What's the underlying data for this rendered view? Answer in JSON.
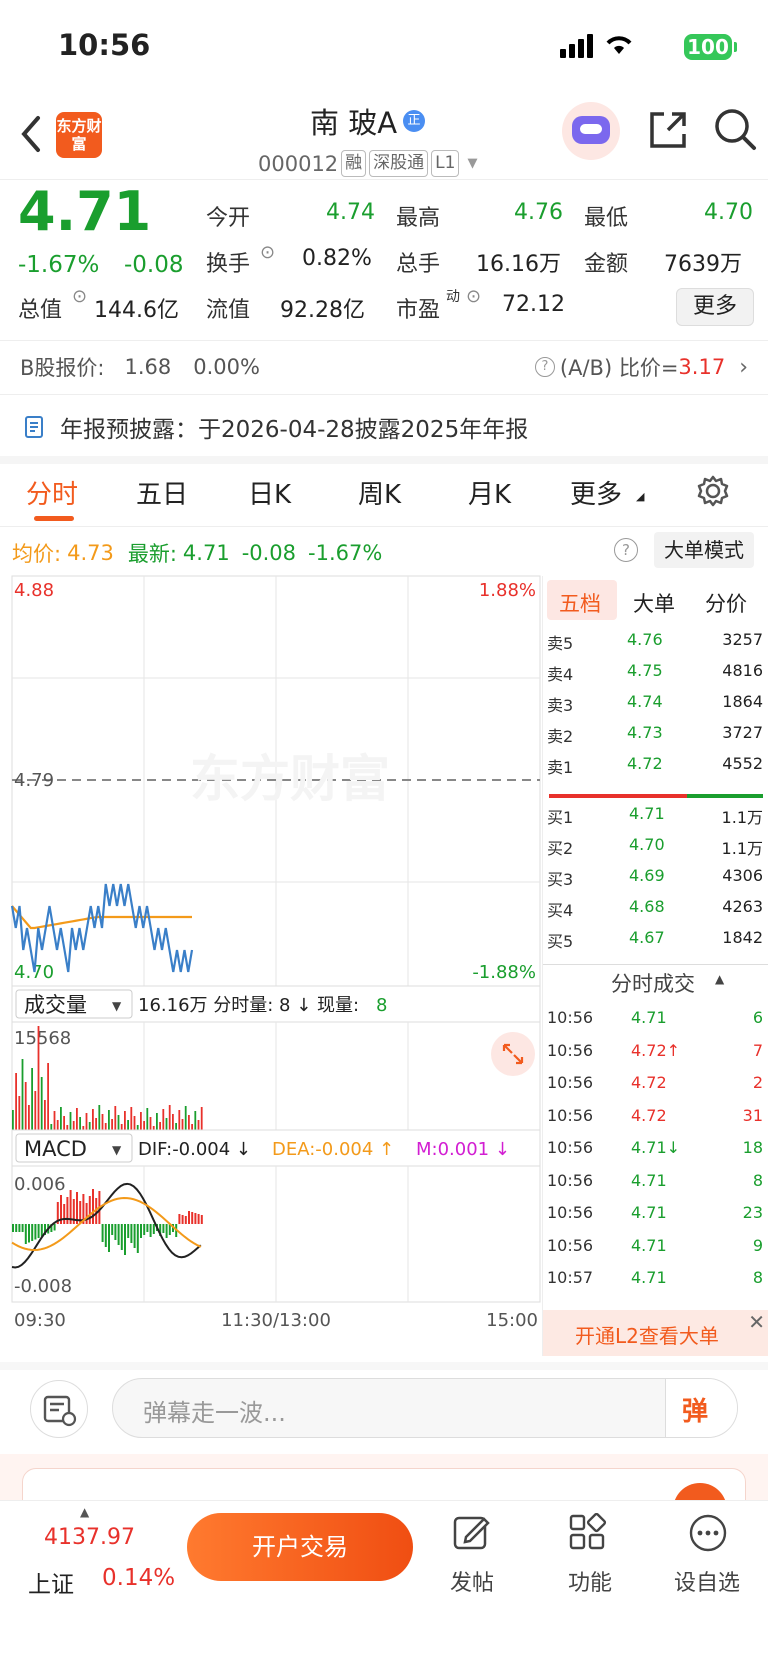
{
  "status_bar": {
    "time": "10:56",
    "battery": "100"
  },
  "header": {
    "logo": "东方财富",
    "stock_name": "南  玻A",
    "stock_badge": "正",
    "stock_code": "000012",
    "tags": [
      "融",
      "深股通",
      "L1"
    ]
  },
  "quote": {
    "price": "4.71",
    "change_pct": "-1.67%",
    "change": "-0.08",
    "open_label": "今开",
    "open": "4.74",
    "high_label": "最高",
    "high": "4.76",
    "low_label": "最低",
    "low": "4.70",
    "turnover_label": "换手",
    "turnover": "0.82%",
    "vol_label": "总手",
    "vol": "16.16万",
    "amount_label": "金额",
    "amount": "7639万",
    "mktcap_label": "总值",
    "mktcap": "144.6亿",
    "float_label": "流值",
    "float": "92.28亿",
    "pe_label": "市盈",
    "pe_sup": "动",
    "pe": "72.12",
    "more": "更多"
  },
  "b_share": {
    "label": "B股报价:",
    "price": "1.68",
    "pct": "0.00%",
    "ratio_label": "(A/B) 比价=",
    "ratio": "3.17"
  },
  "notice": {
    "text": "年报预披露：于2026-04-28披露2025年年报"
  },
  "tabs": [
    "分时",
    "五日",
    "日K",
    "周K",
    "月K",
    "更多"
  ],
  "chart": {
    "avg_label": "均价:",
    "avg": "4.73",
    "last_label": "最新:",
    "last": "4.71",
    "last_chg": "-0.08",
    "last_pct": "-1.67%",
    "big_order_mode": "大单模式",
    "y_top": "4.88",
    "y_mid": "4.79",
    "y_bot": "4.70",
    "pct_top": "1.88%",
    "pct_bot": "-1.88%",
    "watermark": "东方财富",
    "vol_selector": "成交量",
    "vol_info": "16.16万 分时量: 8 ↓ 现量: ",
    "vol_now": "8",
    "vol_max": "15568",
    "macd_selector": "MACD",
    "dif": "DIF:-0.004 ↓",
    "dea": "DEA:-0.004 ↑",
    "m": "M:0.001 ↓",
    "macd_top": "0.006",
    "macd_bot": "-0.008",
    "time_start": "09:30",
    "time_mid": "11:30/13:00",
    "time_end": "15:00"
  },
  "orderbook": {
    "tabs": [
      "五档",
      "大单",
      "分价"
    ],
    "asks": [
      {
        "label": "卖5",
        "price": "4.76",
        "vol": "3257"
      },
      {
        "label": "卖4",
        "price": "4.75",
        "vol": "4816"
      },
      {
        "label": "卖3",
        "price": "4.74",
        "vol": "1864"
      },
      {
        "label": "卖2",
        "price": "4.73",
        "vol": "3727"
      },
      {
        "label": "卖1",
        "price": "4.72",
        "vol": "4552"
      }
    ],
    "bids": [
      {
        "label": "买1",
        "price": "4.71",
        "vol": "1.1万"
      },
      {
        "label": "买2",
        "price": "4.70",
        "vol": "1.1万"
      },
      {
        "label": "买3",
        "price": "4.69",
        "vol": "4306"
      },
      {
        "label": "买4",
        "price": "4.68",
        "vol": "4263"
      },
      {
        "label": "买5",
        "price": "4.67",
        "vol": "1842"
      }
    ],
    "ticks_title": "分时成交",
    "ticks": [
      {
        "time": "10:56",
        "price": "4.71",
        "vol": "6"
      },
      {
        "time": "10:56",
        "price": "4.72↑",
        "vol": "7"
      },
      {
        "time": "10:56",
        "price": "4.72",
        "vol": "2"
      },
      {
        "time": "10:56",
        "price": "4.72",
        "vol": "31"
      },
      {
        "time": "10:56",
        "price": "4.71↓",
        "vol": "18"
      },
      {
        "time": "10:56",
        "price": "4.71",
        "vol": "8"
      },
      {
        "time": "10:56",
        "price": "4.71",
        "vol": "23"
      },
      {
        "time": "10:56",
        "price": "4.71",
        "vol": "9"
      },
      {
        "time": "10:57",
        "price": "4.71",
        "vol": "8"
      }
    ],
    "l2_promo": "开通L2查看大单"
  },
  "comment_bar": {
    "placeholder": "弹幕走一波...",
    "danmu": "弹"
  },
  "bottom": {
    "index_value": "4137.97",
    "index_name": "上证",
    "index_pct": "0.14%",
    "trade_btn": "开户交易",
    "nav": [
      "发帖",
      "功能",
      "设自选"
    ]
  },
  "colors": {
    "up": "#e8312b",
    "down": "#1a9e2e",
    "accent": "#f25b1e",
    "avg_line": "#f39a1a",
    "price_line": "#3a7fc8"
  }
}
